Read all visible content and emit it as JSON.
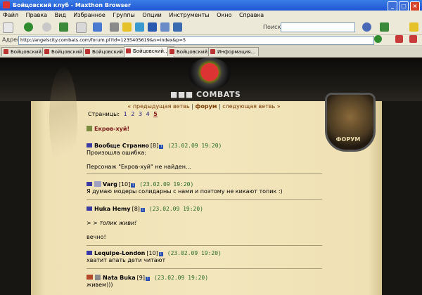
{
  "window": {
    "title": "Бойцовский клуб - Maxthon Browser"
  },
  "menu": [
    "Файл",
    "Правка",
    "Вид",
    "Избранное",
    "Группы",
    "Опции",
    "Инструменты",
    "Окно",
    "Справка"
  ],
  "toolbar": {
    "search_label": "Поиск"
  },
  "address": {
    "label": "Адрес",
    "url": "http://angelscity.combats.com/forum.pl?id=1235405619&n=index&p=5"
  },
  "tabs": [
    {
      "label": "Бойцовский...",
      "active": false
    },
    {
      "label": "Бойцовский...",
      "active": false
    },
    {
      "label": "Бойцовский...",
      "active": false
    },
    {
      "label": "Бойцовский...",
      "active": true
    },
    {
      "label": "Бойцовский...",
      "active": false
    },
    {
      "label": "Информация...",
      "active": false
    }
  ],
  "site": {
    "logo_text": "COMBATS",
    "forum_label": "ФОРУМ"
  },
  "nav": {
    "prev": "« предыдущая ветвь",
    "forum": "форум",
    "next": "следующая ветвь »"
  },
  "pages": {
    "label": "Страницы:",
    "items": [
      "1",
      "2",
      "3",
      "4",
      "5"
    ],
    "current": "5"
  },
  "topic_title": "Екров-хуй!",
  "posts": [
    {
      "nick": "Вообще Странно",
      "level": "[8]",
      "date": "(23.02.09 19:20)",
      "lines": [
        "Произошла ошибка:",
        "",
        "Персонаж \"Екров-хуй\" не найден..."
      ]
    },
    {
      "nick": "Varg",
      "level": "[10]",
      "date": "(23.02.09 19:20)",
      "lines": [
        "Я думаю модеры солидарны с нами и поэтому не кикают топик :)"
      ]
    },
    {
      "nick": "Huka Hemy",
      "level": "[8]",
      "date": "(23.02.09 19:20)",
      "lines": [
        "",
        "> > топик живи!",
        "",
        "вечно!"
      ]
    },
    {
      "nick": "Lequipe-London",
      "level": "[10]",
      "date": "(23.02.09 19:20)",
      "lines": [
        "хватит апать дети читают"
      ]
    },
    {
      "nick": "Nata Buka",
      "level": "[9]",
      "date": "(23.02.09 19:20)",
      "lines": [
        "живем)))"
      ]
    }
  ],
  "colors": {
    "title_bar": "#1f55d4",
    "parchment": "#f3e6bd",
    "date": "#2a6a2a",
    "topic": "#7a1a1a"
  }
}
